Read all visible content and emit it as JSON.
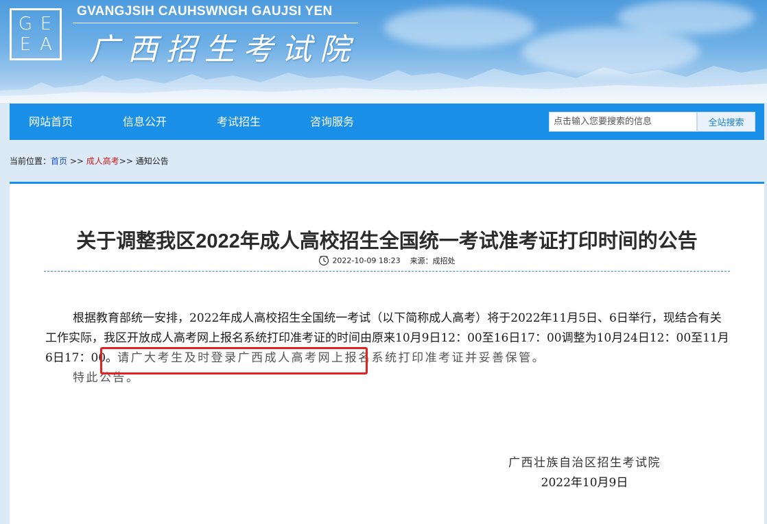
{
  "header": {
    "logo_letters": [
      "G",
      "E",
      "E",
      "A"
    ],
    "site_latin_name": "GVANGJSIH CAUHSWNGH GAUJSI YEN",
    "site_name": "广西招生考试院"
  },
  "nav": {
    "items": [
      {
        "label": "网站首页"
      },
      {
        "label": "信息公开"
      },
      {
        "label": "考试招生"
      },
      {
        "label": "咨询服务"
      }
    ],
    "search_placeholder": "点击输入您要搜索的信息",
    "search_button": "全站搜索"
  },
  "breadcrumb": {
    "prefix": "当前位置：",
    "home": "首页",
    "sep1": " >> ",
    "section": "成人高考",
    "sep2": ">> ",
    "page": "通知公告"
  },
  "article": {
    "title": "关于调整我区2022年成人高校招生全国统一考试准考证打印时间的公告",
    "date": "2022-10-09 18:23",
    "source": "来源：成招处",
    "para1_main": "根据教育部统一安排，2022年成人高校招生全国统一考试（以下简称成人高考）将于2022年11月5日、6日举行，现结合有关工作实际，我区开放成人高考网上报名系统打印准考证的时间由原来10月9日12：00至16日17：00调整为10月24日12：00至11月6日17：00。",
    "para1_tail": "请广大考生及时登录广西成人高考网上报名系统打印准考证并妥善保管。",
    "para2": "特此公告。",
    "signature_org": "广西壮族自治区招生考试院",
    "signature_date": "2022年10月9日"
  },
  "colors": {
    "nav_blue": "#1a8fe8",
    "highlight_red": "#e52020",
    "breadcrumb_link": "#1d4fb8",
    "breadcrumb_current": "#c21b1b"
  },
  "icons": {
    "clock": "clock-icon"
  }
}
